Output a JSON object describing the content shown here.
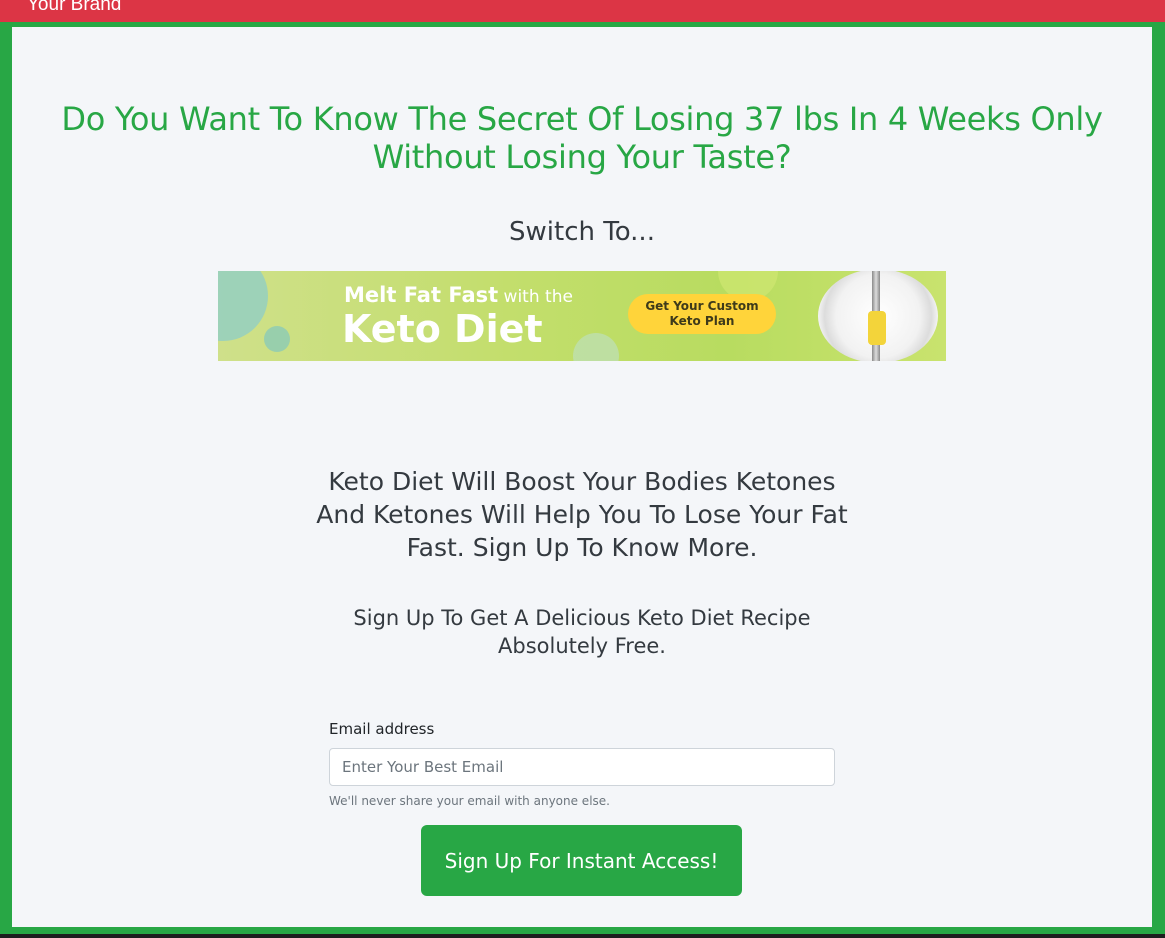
{
  "navbar": {
    "brand": "Your Brand"
  },
  "hero": {
    "headline": "Do You Want To Know The Secret Of Losing 37 lbs In 4 Weeks Only Without Losing Your Taste?",
    "switch_text": "Switch To..."
  },
  "banner": {
    "tagline_bold": "Melt Fat Fast",
    "tagline_rest": " with the",
    "title": "Keto Diet",
    "cta_label": "Get Your Custom Keto Plan"
  },
  "content": {
    "paragraph_1": "Keto Diet Will Boost Your Bodies Ketones And Ketones Will Help You To Lose Your Fat Fast. Sign Up To Know More.",
    "paragraph_2": "Sign Up To Get A Delicious Keto Diet Recipe Absolutely Free."
  },
  "form": {
    "email_label": "Email address",
    "email_placeholder": "Enter Your Best Email",
    "email_value": "",
    "help_text": "We'll never share your email with anyone else.",
    "submit_label": "Sign Up For Instant Access!"
  },
  "colors": {
    "navbar_bg": "#dc3545",
    "accent_green": "#28a745",
    "panel_bg": "#f4f6f9",
    "banner_cta_yellow": "#ffd43a"
  }
}
